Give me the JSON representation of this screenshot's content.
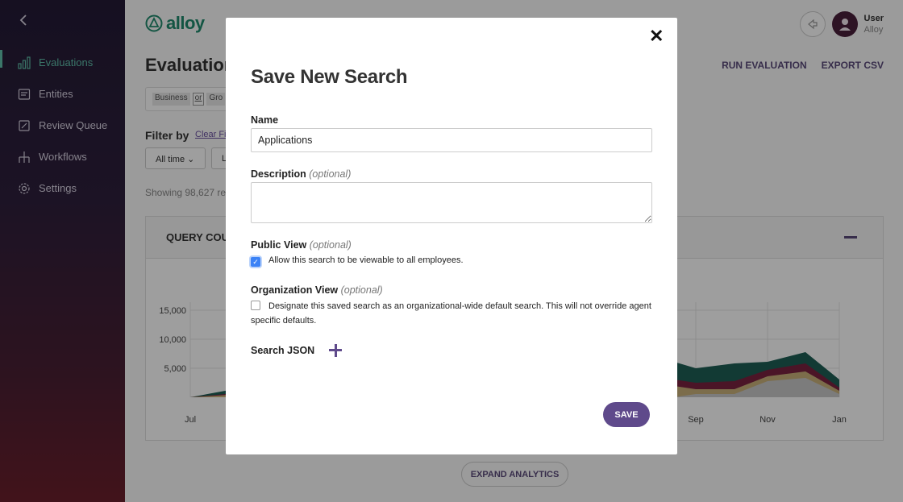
{
  "app": {
    "brand": "alloy",
    "page_title": "Evaluations"
  },
  "sidebar": {
    "items": [
      {
        "label": "Evaluations",
        "icon": "bar-chart-icon",
        "active": true
      },
      {
        "label": "Entities",
        "icon": "entities-icon",
        "active": false
      },
      {
        "label": "Review Queue",
        "icon": "review-queue-icon",
        "active": false
      },
      {
        "label": "Workflows",
        "icon": "workflow-icon",
        "active": false
      },
      {
        "label": "Settings",
        "icon": "gear-icon",
        "active": false
      }
    ]
  },
  "user": {
    "name": "User",
    "org": "Alloy"
  },
  "header": {
    "run_label": "RUN EVALUATION",
    "export_label": "EXPORT CSV"
  },
  "filters": {
    "chip_business": "Business",
    "chip_or": "or",
    "chip_group": "Gro",
    "filter_label": "Filter by",
    "clear_label": "Clear Fi",
    "time_label": "All time",
    "second_label": "L",
    "showing": "Showing 98,627 re"
  },
  "chart_card": {
    "title": "QUERY COU",
    "expand_label": "EXPAND ANALYTICS"
  },
  "chart_data": {
    "type": "area",
    "title": "QUERY COU",
    "y_ticks": [
      "15,000",
      "10,000",
      "5,000"
    ],
    "x_ticks": [
      "Jul",
      "Sep",
      "Nov",
      "Jan"
    ],
    "ylim": [
      0,
      17500
    ],
    "grid": true,
    "legend": "none",
    "series_colors": [
      "#1e5e55",
      "#7a2340",
      "#c9b07a",
      "#c8c8c8"
    ]
  },
  "modal": {
    "title": "Save New Search",
    "name_label": "Name",
    "name_value": "Applications",
    "description_label": "Description",
    "optional_text": "(optional)",
    "public_label": "Public View",
    "public_checkbox_text": "Allow this search to be viewable to all employees.",
    "public_checked": true,
    "org_label": "Organization View",
    "org_checkbox_text": "Designate this saved search as an organizational-wide default search. This will not override agent specific defaults.",
    "org_checked": false,
    "json_label": "Search JSON",
    "save_label": "SAVE"
  },
  "colors": {
    "accent": "#5f4a8b",
    "brand_green": "#1f8a6c",
    "checkbox_blue": "#3b82f6"
  }
}
